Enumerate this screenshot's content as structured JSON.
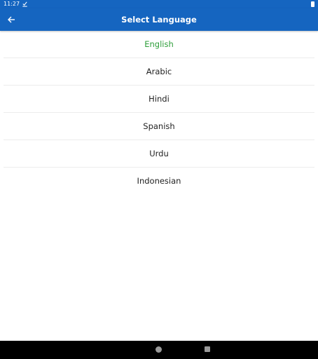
{
  "status_bar": {
    "time": "11:27",
    "icons": [
      "download-done-icon",
      "battery-icon"
    ]
  },
  "app_bar": {
    "title": "Select Language",
    "back_icon": "arrow-left-icon",
    "background": "#1565c0"
  },
  "languages": [
    {
      "label": "English",
      "selected": true
    },
    {
      "label": "Arabic",
      "selected": false
    },
    {
      "label": "Hindi",
      "selected": false
    },
    {
      "label": "Spanish",
      "selected": false
    },
    {
      "label": "Urdu",
      "selected": false
    },
    {
      "label": "Indonesian",
      "selected": false
    }
  ],
  "colors": {
    "selected_text": "#2e9e3a",
    "default_text": "#222222"
  },
  "nav_bar": {
    "icons": [
      "home-circle-icon",
      "recents-square-icon"
    ]
  }
}
